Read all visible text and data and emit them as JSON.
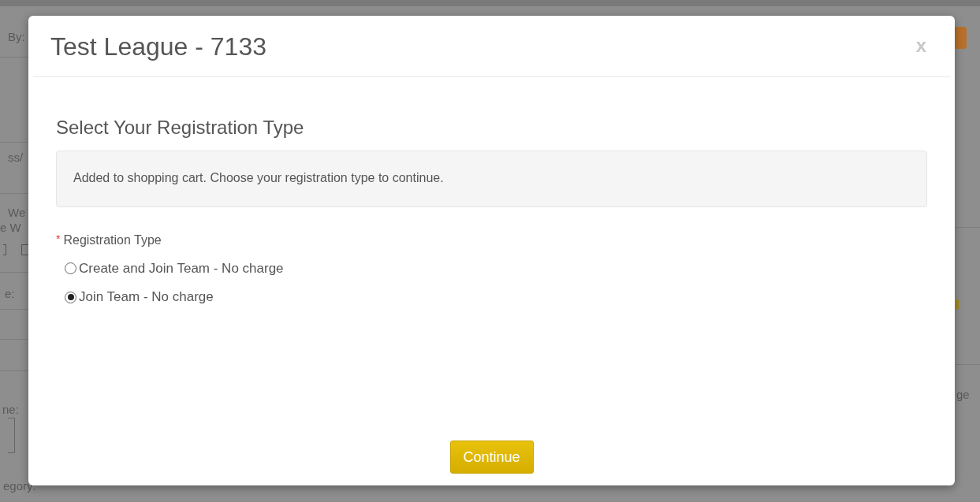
{
  "background_page": {
    "left_fragments": [
      "By:",
      "ss/",
      "We",
      "e W",
      "e:",
      "ne:",
      "egory:"
    ],
    "right_fragments": [
      "ge"
    ],
    "checkboxes": [
      {
        "checked": false
      },
      {
        "checked": false
      }
    ]
  },
  "modal": {
    "title": "Test League - 7133",
    "close": "x",
    "heading": "Select Your Registration Type",
    "notice": "Added to shopping cart. Choose your registration type to continue.",
    "field": {
      "required_mark": "*",
      "label": "Registration Type",
      "options": [
        {
          "label": "Create and Join Team - No charge",
          "selected": false
        },
        {
          "label": "Join Team - No charge",
          "selected": true
        }
      ]
    },
    "button": "Continue"
  }
}
